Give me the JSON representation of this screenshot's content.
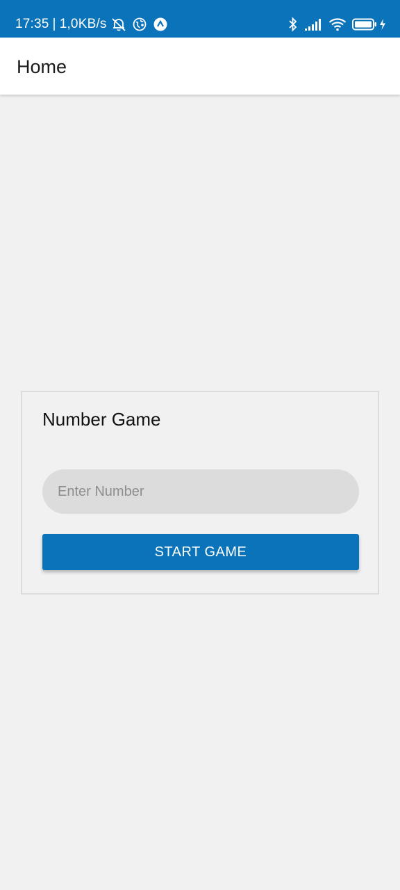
{
  "status_bar": {
    "time": "17:35",
    "separator": "|",
    "network_speed": "1,0KB/s",
    "left_icons": [
      "alarm-off-icon",
      "vpn-globe-icon",
      "arrow-up-circle-icon"
    ],
    "right_icons": [
      "bluetooth-icon",
      "signal-icon",
      "wifi-icon",
      "battery-icon",
      "charging-icon"
    ],
    "background_color": "#0a73b9"
  },
  "app_bar": {
    "title": "Home"
  },
  "card": {
    "title": "Number Game",
    "input": {
      "placeholder": "Enter Number",
      "value": ""
    },
    "start_button_label": "START GAME"
  },
  "colors": {
    "accent": "#0a73b9",
    "background": "#f1f1f1",
    "input_background": "#dcdcdc"
  }
}
